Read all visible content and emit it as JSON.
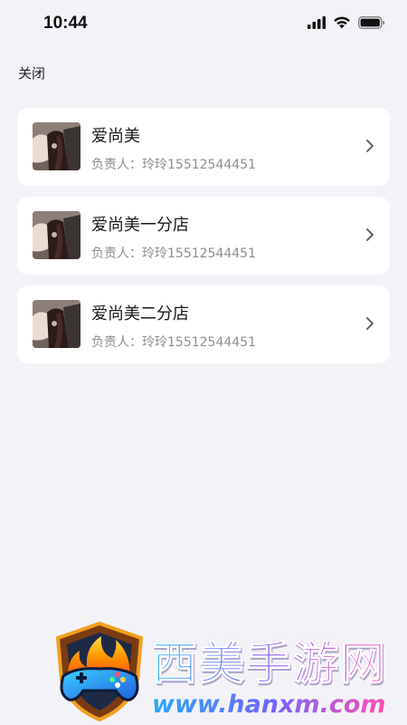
{
  "status_bar": {
    "time": "10:44",
    "icons": [
      "signal-icon",
      "wifi-icon",
      "battery-icon"
    ]
  },
  "header": {
    "close_label": "关闭"
  },
  "stores": [
    {
      "name": "爱尚美",
      "manager_label": "负责人：",
      "manager_value": "玲玲15512544451",
      "icon": "chevron-right-icon"
    },
    {
      "name": "爱尚美一分店",
      "manager_label": "负责人：",
      "manager_value": "玲玲15512544451",
      "icon": "chevron-right-icon"
    },
    {
      "name": "爱尚美二分店",
      "manager_label": "负责人：",
      "manager_value": "玲玲15512544451",
      "icon": "chevron-right-icon"
    }
  ],
  "watermark": {
    "title": "西美手游网",
    "url": "www.hanxm.com"
  },
  "colors": {
    "background": "#f3f2f7",
    "card": "#ffffff",
    "secondary_text": "#8e8e93"
  }
}
